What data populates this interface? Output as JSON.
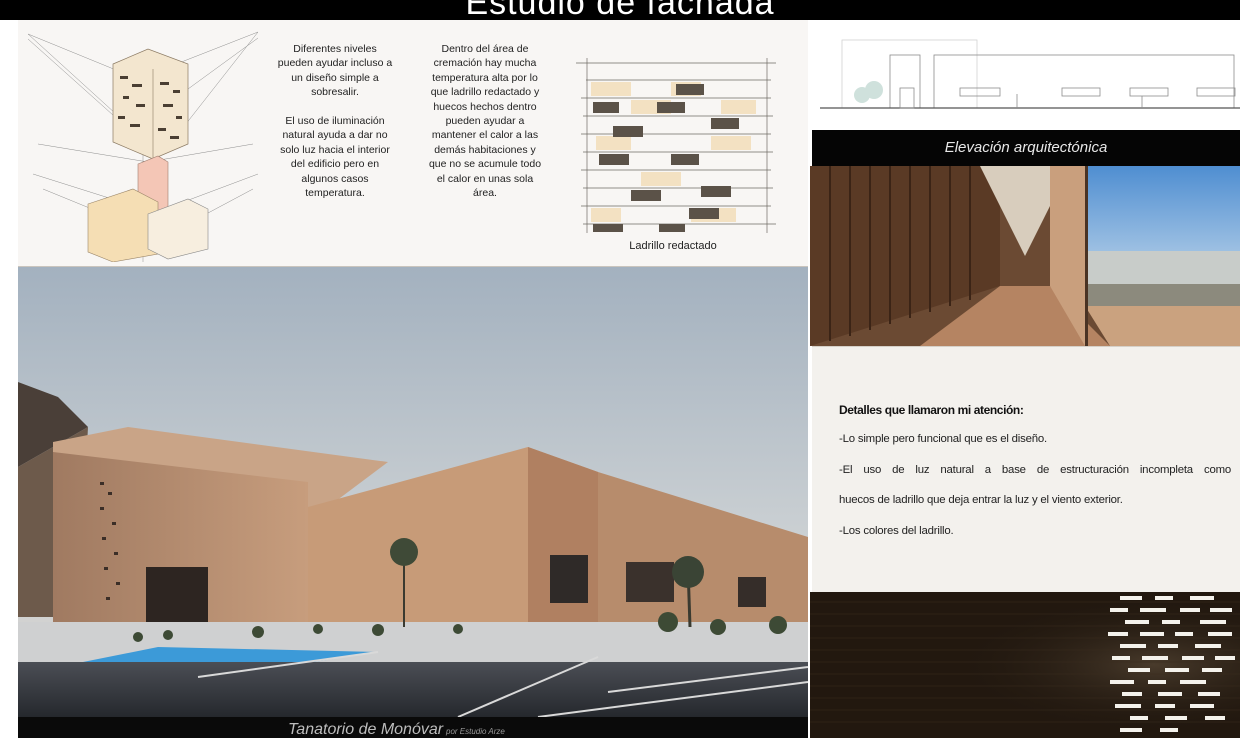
{
  "header": {
    "title": "Estudio de fachada"
  },
  "sketch_panel": {
    "col1": "Diferentes niveles\npueden ayudar incluso a\nun diseño simple a\nsobresalir.\n\nEl uso de iluminación\nnatural ayuda a dar no\nsolo luz hacia el interior\ndel edificio pero en\nalgunos casos\ntemperatura.",
    "col2": "Dentro del área de\ncremación hay mucha\ntemperatura alta por lo\nque ladrillo redactado y\nhuecos hechos dentro\npueden ayudar a\nmantener el calor a las\ndemás habitaciones y\nque no se acumule todo\nel calor en unas sola\nárea.",
    "brick_caption": "Ladrillo redactado"
  },
  "main_photo": {
    "caption": "Tanatorio de Monóvar",
    "caption_sub": "por Estudio Arze"
  },
  "elevation": {
    "label": "Elevación arquitectónica"
  },
  "details": {
    "title": "Detalles que llamaron mi atención:",
    "lines": [
      "-Lo simple pero funcional que es el diseño.",
      "-El uso de luz natural a base de estructuración incompleta como",
      "huecos de ladrillo que deja entrar la luz y el viento exterior.",
      "-Los colores del ladrillo."
    ]
  },
  "colors": {
    "brick": "#b8896a",
    "sky": "#b9c3cf",
    "pool": "#3aa0e0",
    "bars": "#000000"
  }
}
